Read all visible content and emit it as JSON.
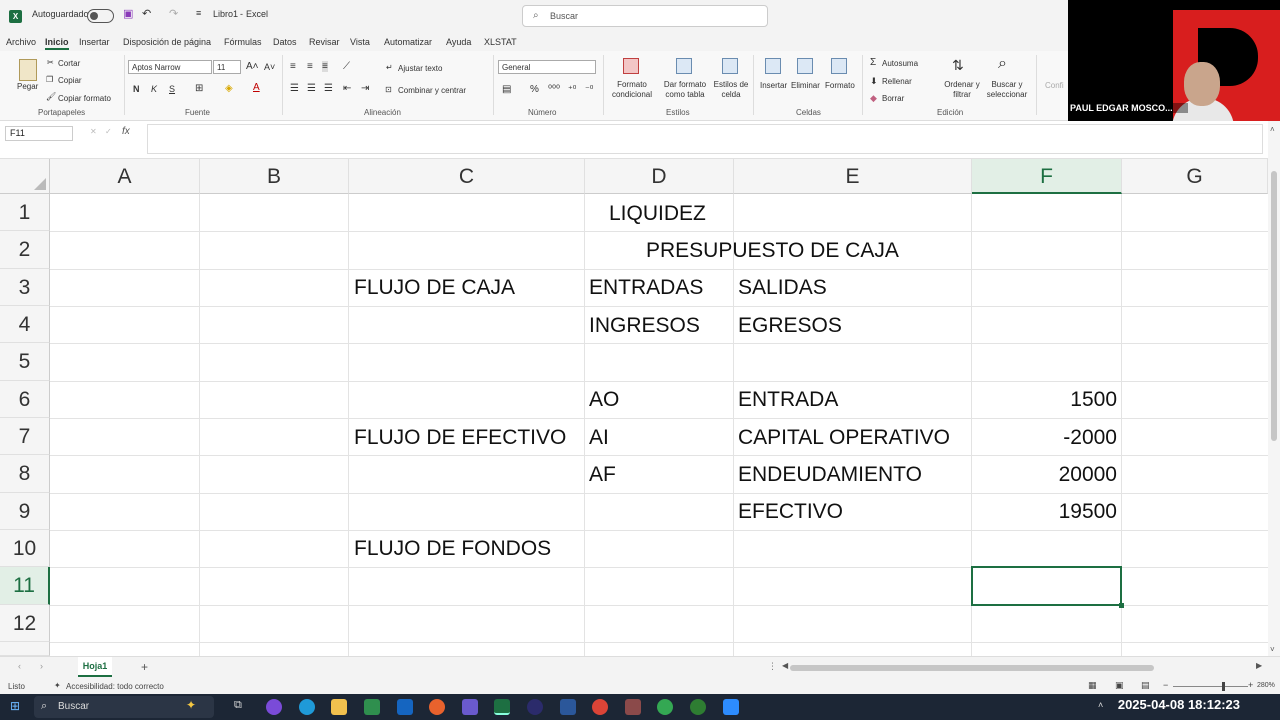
{
  "titlebar": {
    "autosave_label": "Autoguardado",
    "filename": "Libro1",
    "app": "Excel",
    "separator": "-",
    "search_placeholder": "Buscar"
  },
  "menu": {
    "tabs": [
      "Archivo",
      "Inicio",
      "Insertar",
      "Disposición de página",
      "Fórmulas",
      "Datos",
      "Revisar",
      "Vista",
      "Automatizar",
      "Ayuda",
      "XLSTAT"
    ],
    "active": "Inicio"
  },
  "ribbon": {
    "paste": "Pegar",
    "cut": "Cortar",
    "copy": "Copiar",
    "format_painter": "Copiar formato",
    "group_clipboard": "Portapapeles",
    "font_name": "Aptos Narrow",
    "font_size": "11",
    "bold": "N",
    "italic": "K",
    "underline": "S",
    "group_font": "Fuente",
    "wrap_text": "Ajustar texto",
    "merge_center": "Combinar y centrar",
    "group_alignment": "Alineación",
    "number_format": "General",
    "percent": "%",
    "group_number": "Número",
    "conditional_format": "Formato condicional",
    "format_table": "Dar formato como tabla",
    "cell_styles": "Estilos de celda",
    "group_styles": "Estilos",
    "insert": "Insertar",
    "delete": "Eliminar",
    "format": "Formato",
    "group_cells": "Celdas",
    "autosum": "Autosuma",
    "fill": "Rellenar",
    "clear": "Borrar",
    "sort_filter": "Ordenar y filtrar",
    "find_select": "Buscar y seleccionar",
    "group_editing": "Edición",
    "confi_cut": "Confi"
  },
  "formula_bar": {
    "name_box": "F11",
    "fx": "fx",
    "content": ""
  },
  "sheet": {
    "columns": [
      "A",
      "B",
      "C",
      "D",
      "E",
      "F",
      "G"
    ],
    "selected_column": "F",
    "rows": [
      "1",
      "2",
      "3",
      "4",
      "5",
      "6",
      "7",
      "8",
      "9",
      "10",
      "11",
      "12"
    ],
    "selected_row": "11",
    "cells": {
      "D1": "LIQUIDEZ",
      "D2": "PRESUPUESTO DE CAJA",
      "C3": "FLUJO DE CAJA",
      "D3": "ENTRADAS",
      "E3": "SALIDAS",
      "D4": "INGRESOS",
      "E4": "EGRESOS",
      "D6": "AO",
      "E6": "ENTRADA",
      "F6": "1500",
      "C7": "FLUJO DE EFECTIVO",
      "D7": "AI",
      "E7": "CAPITAL OPERATIVO",
      "F7": "-2000",
      "D8": "AF",
      "E8": "ENDEUDAMIENTO",
      "F8": "20000",
      "E9": "EFECTIVO",
      "F9": "19500",
      "C10": "FLUJO DE FONDOS"
    }
  },
  "sheet_tabs": {
    "active": "Hoja1",
    "add": "+"
  },
  "status": {
    "ready": "Listo",
    "accessibility": "Accesibilidad: todo correcto",
    "zoom": "280%"
  },
  "taskbar": {
    "search": "Buscar",
    "clock": "2025-04-08  18:12:23"
  },
  "webcam": {
    "name": "PAUL EDGAR MOSCO..."
  },
  "colors": {
    "excel_green": "#1d6f42",
    "taskbar": "#1c2635"
  }
}
